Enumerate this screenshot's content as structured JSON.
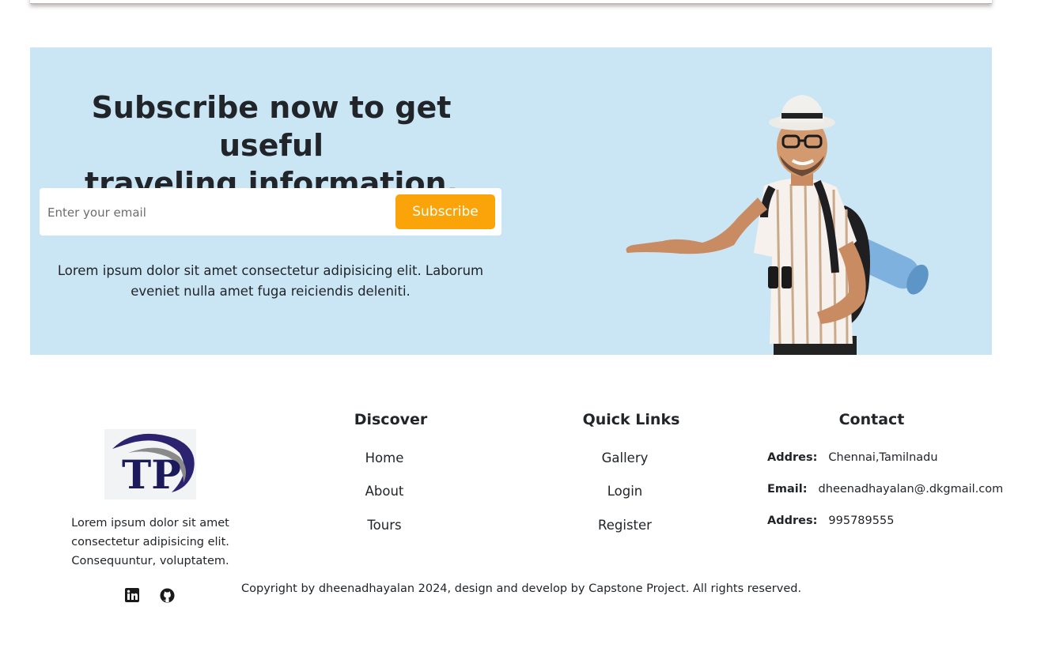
{
  "newsletter": {
    "title_line1": "Subscribe now to get useful",
    "title_line2": "traveling information.",
    "email_placeholder": "Enter your email",
    "subscribe_label": "Subscribe",
    "description": "Lorem ipsum dolor sit amet consectetur adipisicing elit. Laborum eveniet nulla amet fuga reiciendis deleniti."
  },
  "footer": {
    "logo_text": "TP",
    "about": "Lorem ipsum dolor sit amet consectetur adipisicing elit. Consequuntur, voluptatem.",
    "social": [
      "linkedin-icon",
      "github-icon"
    ],
    "discover": {
      "title": "Discover",
      "links": [
        "Home",
        "About",
        "Tours"
      ]
    },
    "quick_links": {
      "title": "Quick Links",
      "links": [
        "Gallery",
        "Login",
        "Register"
      ]
    },
    "contact": {
      "title": "Contact",
      "rows": [
        {
          "label": "Addres:",
          "value": "Chennai,Tamilnadu"
        },
        {
          "label": "Email:",
          "value": "dheenadhayalan@.dkgmail.com"
        },
        {
          "label": "Addres:",
          "value": "995789555"
        }
      ]
    },
    "copyright": "Copyright by dheenadhayalan 2024, design and develop by Capstone Project. All rights reserved."
  },
  "colors": {
    "newsletter_bg": "#cae5f4",
    "subscribe_button": "#faa40a",
    "text": "#212529"
  }
}
